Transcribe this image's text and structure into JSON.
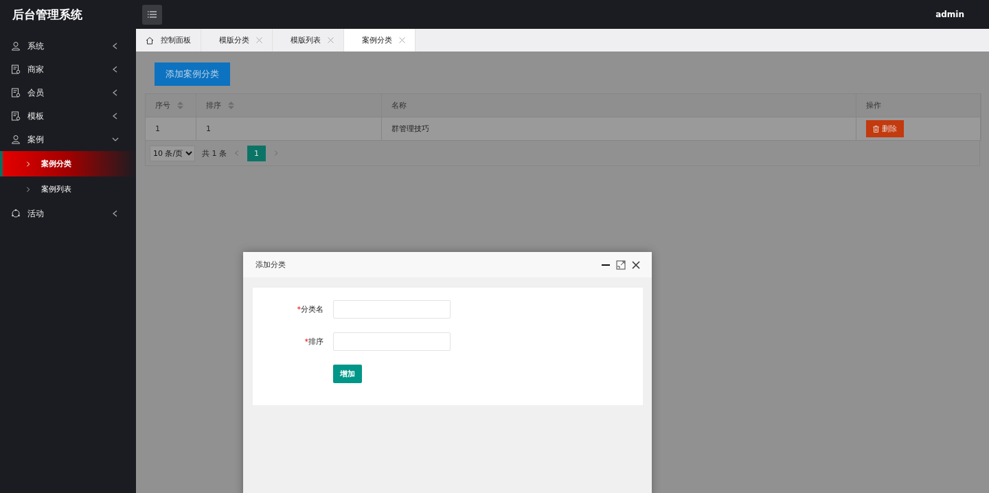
{
  "header": {
    "title": "后台管理系统",
    "user": "admin"
  },
  "sidebar": {
    "items": [
      {
        "label": "系统",
        "kind": "user",
        "expanded": false
      },
      {
        "label": "商家",
        "kind": "card",
        "expanded": false
      },
      {
        "label": "会员",
        "kind": "card",
        "expanded": false
      },
      {
        "label": "模板",
        "kind": "card",
        "expanded": false
      },
      {
        "label": "案例",
        "kind": "user",
        "expanded": true,
        "children": [
          {
            "label": "案例分类",
            "selected": true
          },
          {
            "label": "案例列表",
            "selected": false
          }
        ]
      },
      {
        "label": "活动",
        "kind": "cycle",
        "expanded": false
      }
    ]
  },
  "tabs": [
    {
      "label": "控制面板",
      "kind": "home",
      "selected": false
    },
    {
      "label": "模版分类",
      "kind": "closable",
      "selected": false
    },
    {
      "label": "模版列表",
      "kind": "closable",
      "selected": false
    },
    {
      "label": "案例分类",
      "kind": "closable",
      "selected": true
    }
  ],
  "toolbar": {
    "add_button": "添加案例分类"
  },
  "table": {
    "columns": [
      {
        "label": "序号",
        "sortable": true
      },
      {
        "label": "排序",
        "sortable": true
      },
      {
        "label": "名称",
        "sortable": false
      },
      {
        "label": "操作",
        "sortable": false
      }
    ],
    "rows": [
      {
        "cells": [
          "1",
          "1",
          "群管理技巧"
        ],
        "action": "删除"
      }
    ]
  },
  "pagination": {
    "page_size": "10 条/页",
    "total": "共 1 条",
    "pages": [
      {
        "label": "1",
        "selected": true
      }
    ]
  },
  "dialog": {
    "title": "添加分类",
    "fields": [
      {
        "label": "分类名",
        "required_mark": "*"
      },
      {
        "label": "排序",
        "required_mark": "*"
      }
    ],
    "submit": "增加"
  }
}
